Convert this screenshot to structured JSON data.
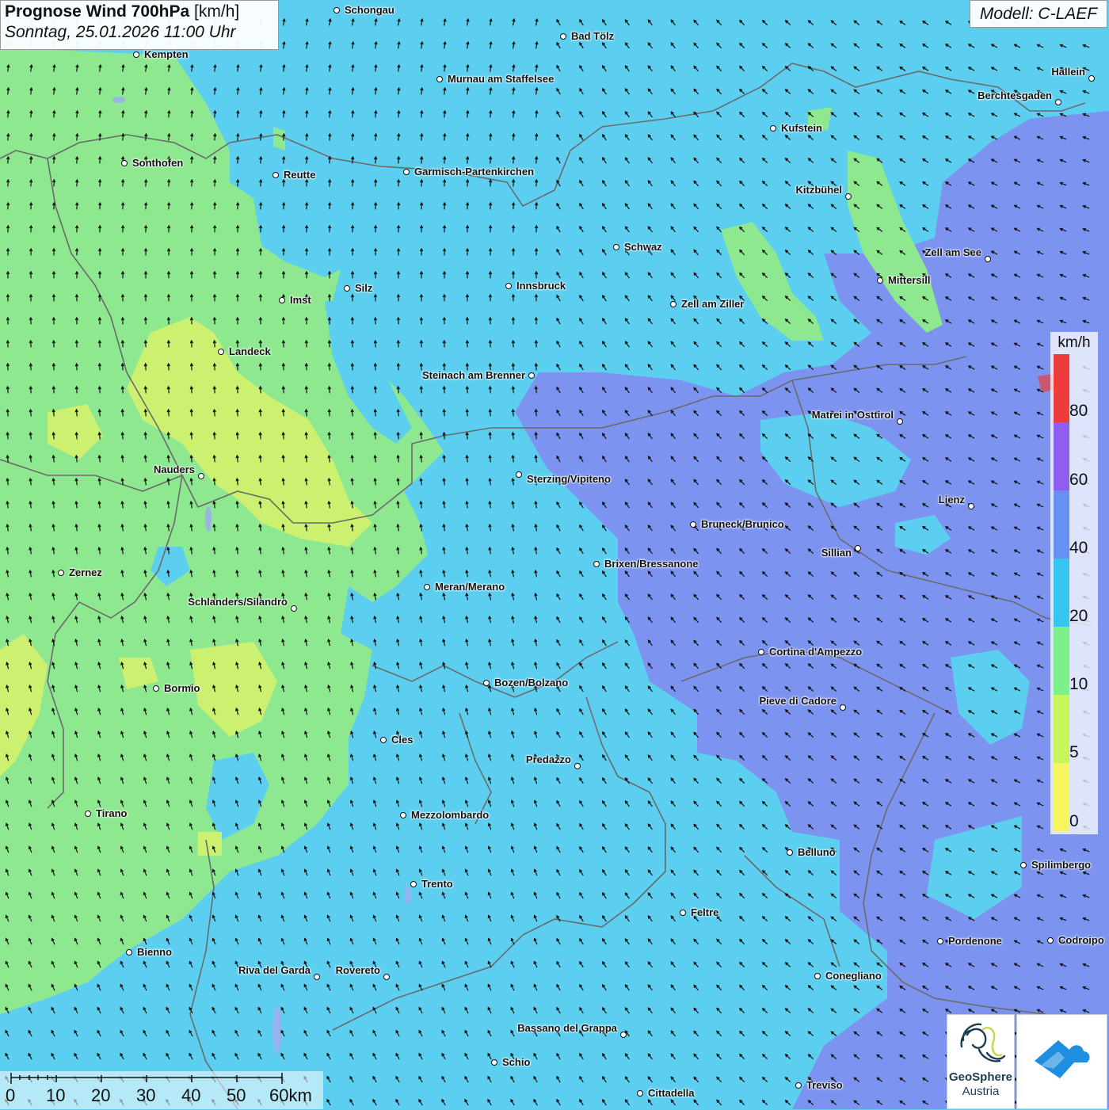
{
  "header": {
    "title_bold": "Prognose Wind 700hPa",
    "title_unit": "[km/h]",
    "datetime": "Sonntag, 25.01.2026 11:00 Uhr",
    "model": "Modell: C-LAEF"
  },
  "legend": {
    "unit": "km/h",
    "labels": [
      "80",
      "60",
      "40",
      "20",
      "10",
      "5",
      "0"
    ],
    "colors": [
      "#ee3b3b",
      "#8e5ef0",
      "#6592f2",
      "#35c6ef",
      "#7ef08a",
      "#c8f55a",
      "#f5f560"
    ]
  },
  "cities": [
    {
      "name": "Schongau"
    },
    {
      "name": "Bad Tölz"
    },
    {
      "name": "Kempten"
    },
    {
      "name": "Murnau am Staffelsee"
    },
    {
      "name": "Hallein"
    },
    {
      "name": "Berchtesgaden"
    },
    {
      "name": "Kufstein"
    },
    {
      "name": "Sonthofen"
    },
    {
      "name": "Reutte"
    },
    {
      "name": "Garmisch-Partenkirchen"
    },
    {
      "name": "Kitzbühel"
    },
    {
      "name": "Schwaz"
    },
    {
      "name": "Zell am See"
    },
    {
      "name": "Mittersill"
    },
    {
      "name": "Silz"
    },
    {
      "name": "Innsbruck"
    },
    {
      "name": "Imst"
    },
    {
      "name": "Zell am Ziller"
    },
    {
      "name": "Landeck"
    },
    {
      "name": "Steinach am Brenner"
    },
    {
      "name": "Matrei in Osttirol"
    },
    {
      "name": "Nauders"
    },
    {
      "name": "Sterzing/Vipiteno"
    },
    {
      "name": "Lienz"
    },
    {
      "name": "Bruneck/Brunico"
    },
    {
      "name": "Sillian"
    },
    {
      "name": "Brixen/Bressanone"
    },
    {
      "name": "Zernez"
    },
    {
      "name": "Meran/Merano"
    },
    {
      "name": "Schlanders/Silandro"
    },
    {
      "name": "Cortina d'Ampezzo"
    },
    {
      "name": "Bozen/Bolzano"
    },
    {
      "name": "Bormio"
    },
    {
      "name": "Pieve di Cadore"
    },
    {
      "name": "Cles"
    },
    {
      "name": "Predazzo"
    },
    {
      "name": "Tirano"
    },
    {
      "name": "Mezzolombardo"
    },
    {
      "name": "Belluno"
    },
    {
      "name": "Spilimbergo"
    },
    {
      "name": "Trento"
    },
    {
      "name": "Feltre"
    },
    {
      "name": "Pordenone"
    },
    {
      "name": "Codroipo"
    },
    {
      "name": "Bienno"
    },
    {
      "name": "Riva del Garda"
    },
    {
      "name": "Rovereto"
    },
    {
      "name": "Conegliano"
    },
    {
      "name": "Bassano del Grappa"
    },
    {
      "name": "Schio"
    },
    {
      "name": "Treviso"
    },
    {
      "name": "Cittadella"
    }
  ],
  "scale": {
    "ticks": [
      "0",
      "10",
      "20",
      "30",
      "40",
      "50",
      "60km"
    ]
  },
  "logos": {
    "geosphere_line1": "GeoSphere",
    "geosphere_line2": "Austria"
  },
  "colors": {
    "wind_10_20": "#8ee88f",
    "wind_5_10": "#ccf070",
    "wind_20_40": "#5ccff0",
    "wind_40_60": "#7c94f0",
    "border_line": "#6a6a6a",
    "brand_blue": "#1e8ee0"
  }
}
